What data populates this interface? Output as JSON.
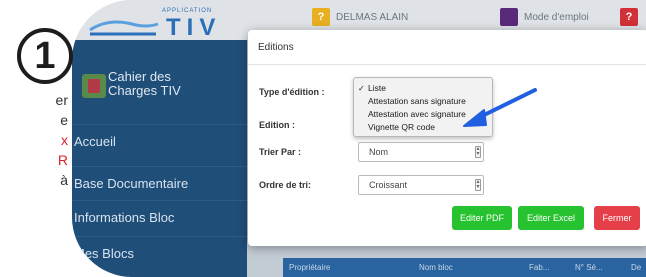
{
  "left_text": [
    {
      "text": "er",
      "red": false
    },
    {
      "text": "e",
      "red": false
    },
    {
      "text": "x",
      "red": true
    },
    {
      "text": "R",
      "red": true
    },
    {
      "text": "à",
      "red": false
    }
  ],
  "step_badge": "1",
  "app": {
    "small_label": "APPLICATION",
    "name": "TIV"
  },
  "topbar": {
    "user_label": "DELMAS ALAIN",
    "help_label": "Mode d'emploi",
    "user_icon_glyph": "?",
    "help_icon_glyph": "",
    "third_icon_glyph": "?"
  },
  "sidebar": {
    "header": {
      "line1": "Cahier des",
      "line2": "Charges TIV"
    },
    "items": [
      {
        "label": "Accueil"
      },
      {
        "label": "Base Documentaire"
      },
      {
        "label": "Informations Bloc"
      },
      {
        "label": "Mes Blocs"
      }
    ]
  },
  "table": {
    "headers": [
      "Propriétaire",
      "Nom bloc",
      "Fab...",
      "N° Sé...",
      "De"
    ]
  },
  "modal": {
    "title": "Editions",
    "fields": {
      "type_label": "Type d'édition :",
      "edition_label": "Edition :",
      "trier_label": "Trier Par :",
      "ordre_label": "Ordre de tri:"
    },
    "dropdown_options": [
      {
        "label": "Liste",
        "checked": true
      },
      {
        "label": "Attestation sans signature",
        "checked": false
      },
      {
        "label": "Attestation avec signature",
        "checked": false
      },
      {
        "label": "Vignette QR code",
        "checked": false
      }
    ],
    "trier_value": "Nom",
    "ordre_value": "Croissant",
    "buttons": {
      "pdf": "Editer PDF",
      "excel": "Editer Excel",
      "close": "Fermer"
    }
  },
  "colors": {
    "accent_blue": "#2a6fb8",
    "sidebar": "#1f4e79",
    "button_green": "#27c22f",
    "button_red": "#e5404a",
    "text_red": "#d9242b",
    "arrow_blue": "#1f5fe0"
  }
}
